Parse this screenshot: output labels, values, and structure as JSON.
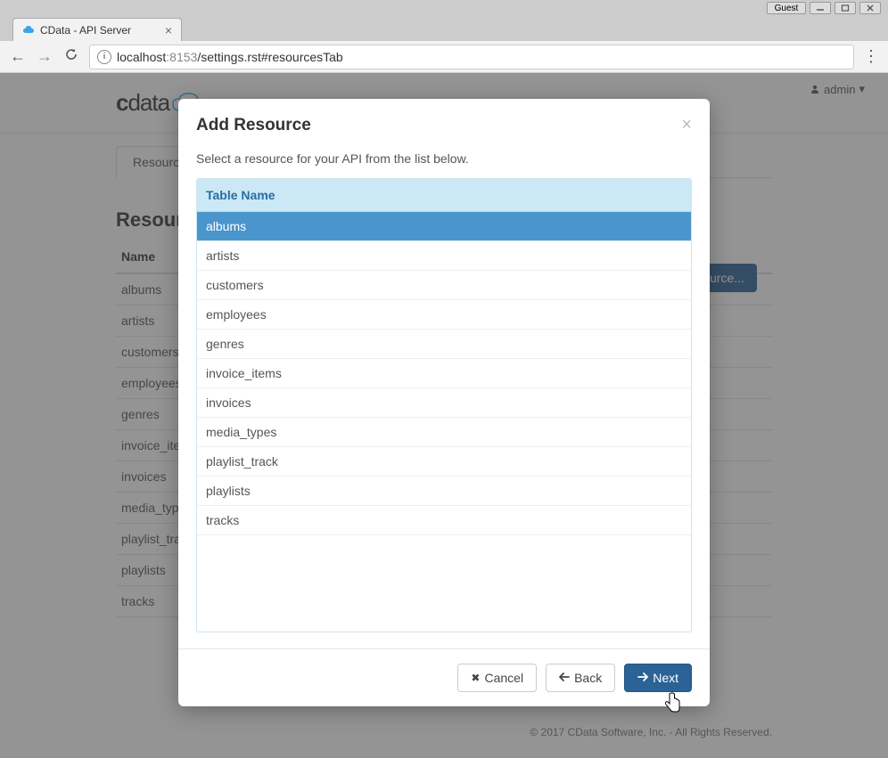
{
  "window": {
    "guest_label": "Guest"
  },
  "browser": {
    "tab_title": "CData - API Server",
    "url_host": "localhost",
    "url_port": ":8153",
    "url_path": "/settings.rst#resourcesTab"
  },
  "header": {
    "user_label": "admin"
  },
  "page": {
    "tab_label": "Resources",
    "section_title": "Resources",
    "name_header": "Name",
    "add_button": "Add Resource...",
    "resources": [
      "albums",
      "artists",
      "customers",
      "employees",
      "genres",
      "invoice_items",
      "invoices",
      "media_types",
      "playlist_track",
      "playlists",
      "tracks"
    ]
  },
  "modal": {
    "title": "Add Resource",
    "description": "Select a resource for your API from the list below.",
    "table_header": "Table Name",
    "rows": [
      "albums",
      "artists",
      "customers",
      "employees",
      "genres",
      "invoice_items",
      "invoices",
      "media_types",
      "playlist_track",
      "playlists",
      "tracks"
    ],
    "selected_index": 0,
    "cancel_label": "Cancel",
    "back_label": "Back",
    "next_label": "Next"
  },
  "footer": {
    "copyright": "© 2017 CData Software, Inc. - All Rights Reserved."
  }
}
